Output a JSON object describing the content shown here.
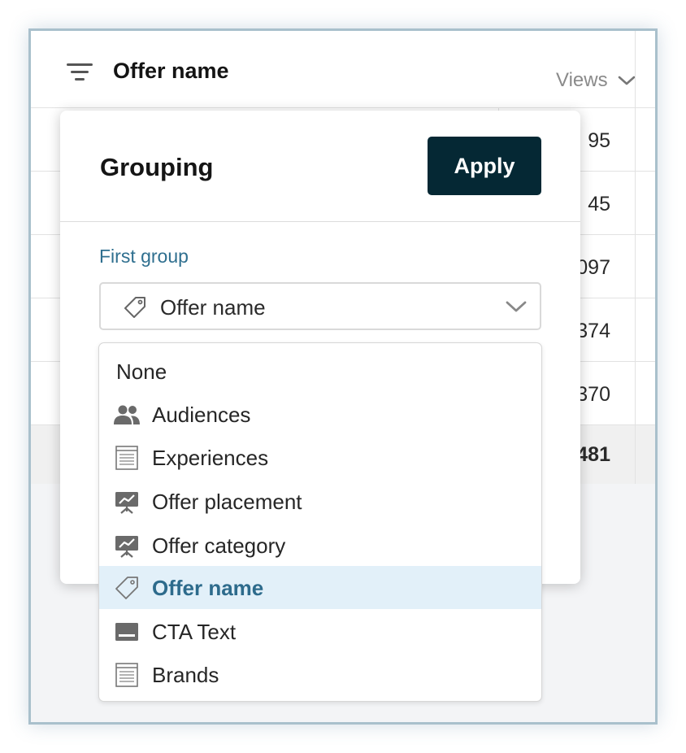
{
  "table": {
    "column_title": "Offer name",
    "views_label": "Views",
    "rows": [
      {
        "value": "95"
      },
      {
        "value": "45"
      },
      {
        "value": "097"
      },
      {
        "value": "374"
      },
      {
        "value": "370"
      }
    ],
    "total": {
      "value": "481"
    }
  },
  "popover": {
    "title": "Grouping",
    "apply_label": "Apply",
    "first_group_label": "First group",
    "selected_value": "Offer name"
  },
  "dropdown": {
    "options": [
      {
        "label": "None",
        "icon": "none"
      },
      {
        "label": "Audiences",
        "icon": "people-icon"
      },
      {
        "label": "Experiences",
        "icon": "document-icon"
      },
      {
        "label": "Offer placement",
        "icon": "presentation-chart-icon"
      },
      {
        "label": "Offer category",
        "icon": "presentation-chart-icon"
      },
      {
        "label": "Offer name",
        "icon": "tag-icon",
        "selected": true
      },
      {
        "label": "CTA Text",
        "icon": "cta-box-icon"
      },
      {
        "label": "Brands",
        "icon": "document-icon"
      }
    ]
  },
  "colors": {
    "apply_button": "#052834",
    "accent_text": "#2f6f8f",
    "selected_option_bg": "#e2f0f9"
  }
}
